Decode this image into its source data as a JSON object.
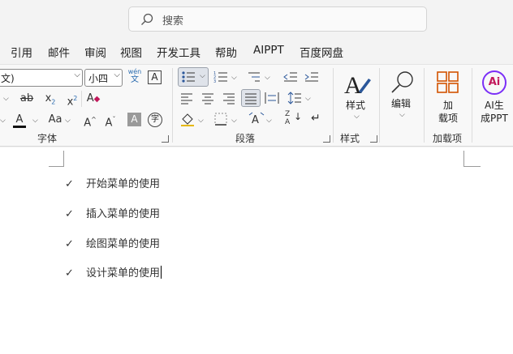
{
  "search": {
    "placeholder": "搜索",
    "icon": "search-icon"
  },
  "menu": [
    "引用",
    "邮件",
    "审阅",
    "视图",
    "开发工具",
    "帮助",
    "AIPPT",
    "百度网盘"
  ],
  "ribbon": {
    "font": {
      "font_name_value": "文)",
      "font_size_value": "小四",
      "phonetic_top": "wén",
      "phonetic_bottom": "文",
      "char_border_label": "A",
      "strike_label": "ab",
      "subscript_label": "x",
      "subscript_sub": "2",
      "superscript_label": "x",
      "superscript_sup": "2",
      "clear_format_label": "A",
      "font_color_label": "A",
      "change_case_label": "Aa",
      "grow_label": "A",
      "shrink_label": "A",
      "char_shading_label": "A",
      "enclose_label": "字",
      "group_label": "字体"
    },
    "paragraph": {
      "group_label": "段落",
      "sort_label_top": "Z",
      "sort_label_bottom": "A"
    },
    "styles": {
      "button_label": "样式",
      "group_label": "样式"
    },
    "editing": {
      "button_label": "编辑"
    },
    "addins": {
      "button_label_1": "加",
      "button_label_2": "载项",
      "group_label": "加载项"
    },
    "ai": {
      "icon_text": "Ai",
      "button_label_1": "AI生",
      "button_label_2": "成PPT"
    },
    "accent_color": "#2b579a"
  },
  "document": {
    "items": [
      {
        "check": "✓",
        "text": "开始菜单的使用"
      },
      {
        "check": "✓",
        "text": "插入菜单的使用"
      },
      {
        "check": "✓",
        "text": "绘图菜单的使用"
      },
      {
        "check": "✓",
        "text": "设计菜单的使用"
      }
    ]
  }
}
